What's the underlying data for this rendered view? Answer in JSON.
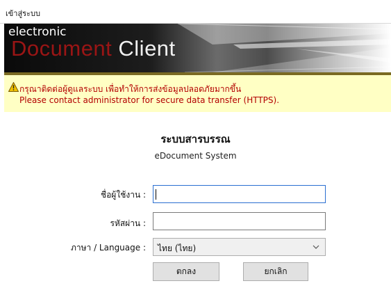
{
  "window": {
    "title": "เข้าสู่ระบบ"
  },
  "banner": {
    "brand_small": "electronic",
    "brand_document": "Document",
    "brand_client": " Client"
  },
  "warning": {
    "line_th": "กรุณาติดต่อผู้ดูแลระบบ เพื่อทำให้การส่งข้อมูลปลอดภัยมากขึ้น",
    "line_en": "Please contact administrator for secure data transfer (HTTPS).",
    "icon": "warning-triangle-icon"
  },
  "system": {
    "title_th": "ระบบสารบรรณ",
    "title_en": "eDocument System"
  },
  "form": {
    "username_label": "ชื่อผู้ใช้งาน :",
    "username_value": "",
    "password_label": "รหัสผ่าน :",
    "password_value": "",
    "language_label": "ภาษา / Language :",
    "language_selected": "ไทย (ไทย)"
  },
  "buttons": {
    "ok_label": "ตกลง",
    "cancel_label": "ยกเลิก"
  },
  "colors": {
    "warning_text": "#b30000",
    "warning_bg": "#ffffc4",
    "brand_red": "#9a1515",
    "focus_border": "#2a6fd1"
  }
}
